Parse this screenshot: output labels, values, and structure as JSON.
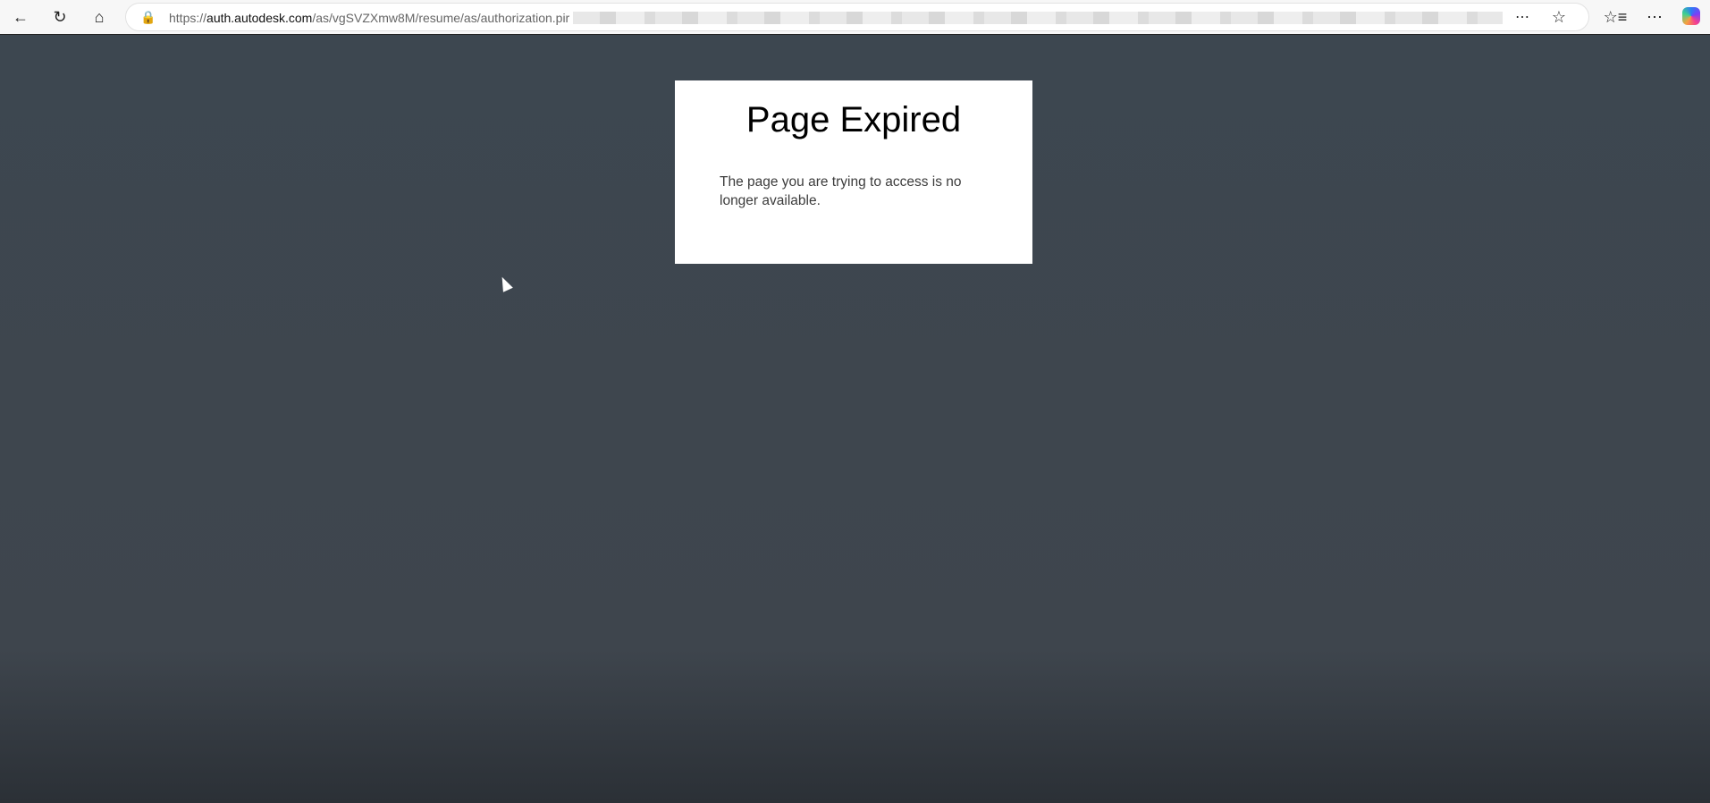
{
  "browser": {
    "url_scheme": "https://",
    "url_host": "auth.autodesk.com",
    "url_path": "/as/vgSVZXmw8M/resume/as/authorization.pir",
    "icons": [
      "back-icon",
      "refresh-icon",
      "home-icon",
      "lock-icon",
      "read-aloud-icon",
      "favorite-star-icon",
      "favorites-list-icon",
      "more-icon",
      "copilot-icon"
    ]
  },
  "page": {
    "title": "Page Expired",
    "message": "The page you are trying to access is no longer available."
  }
}
